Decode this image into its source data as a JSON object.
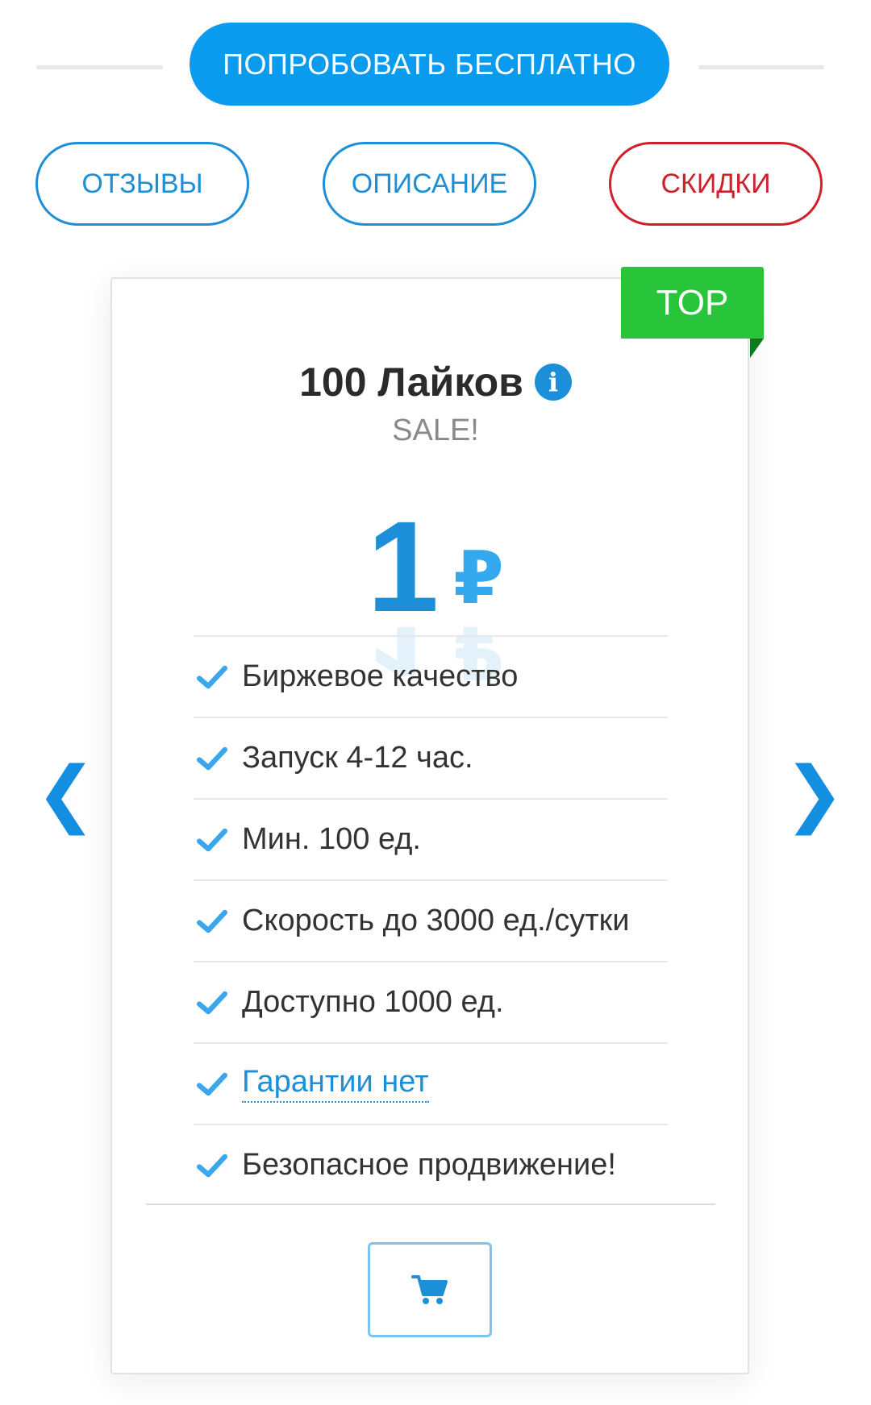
{
  "promo": {
    "try_free_label": "ПОПРОБОВАТЬ БЕСПЛАТНО"
  },
  "tabs": [
    {
      "label": "ОТЗЫВЫ"
    },
    {
      "label": "ОПИСАНИЕ"
    },
    {
      "label": "СКИДКИ"
    }
  ],
  "carousel": {
    "prev_icon": "chevron-left-icon",
    "next_icon": "chevron-right-icon"
  },
  "card": {
    "ribbon": "TOP",
    "title": "100 Лайков",
    "info_icon": "info-icon",
    "subtitle": "SALE!",
    "price": "1",
    "currency": "₽",
    "features": [
      "Биржевое качество",
      "Запуск 4-12 час.",
      "Мин. 100 ед.",
      "Скорость до 3000 ед./сутки",
      "Доступно 1000 ед.",
      "Гарантии нет",
      "Безопасное продвижение!"
    ],
    "cart_icon": "cart-icon"
  },
  "colors": {
    "accent": "#1d8fd8",
    "primary_button": "#0a9bef",
    "discount": "#d0202a",
    "ribbon": "#28c53a"
  }
}
